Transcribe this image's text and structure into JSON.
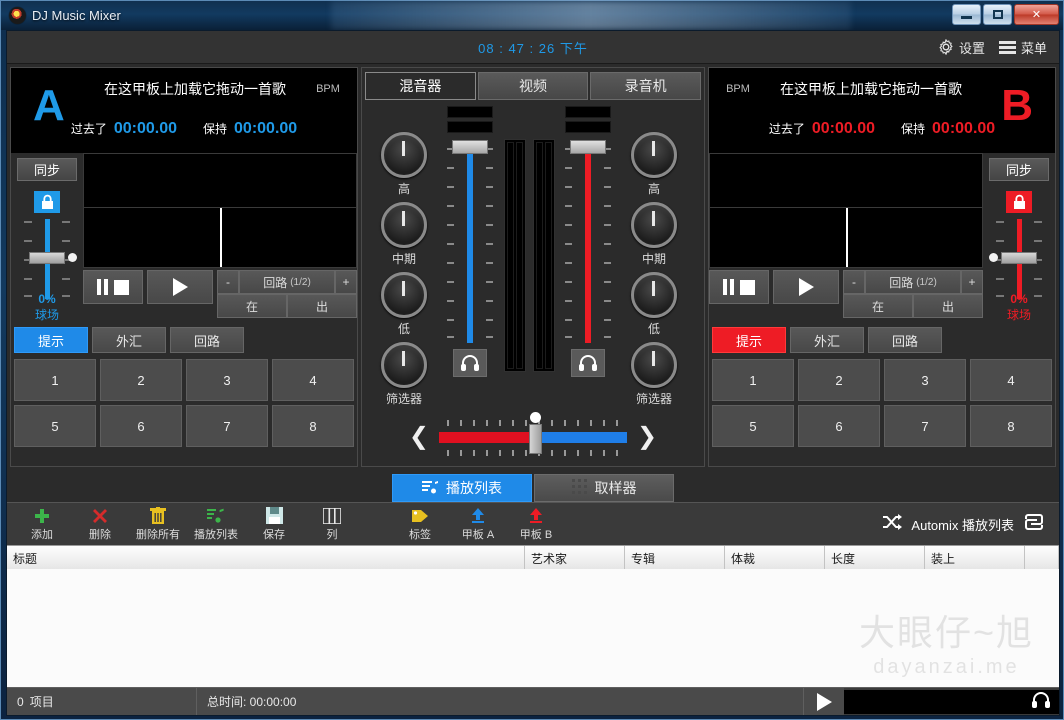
{
  "window": {
    "title": "DJ Music Mixer",
    "icon": "vinyl-record-icon",
    "minimize": "—",
    "maximize": "□",
    "close": "✕"
  },
  "topbar": {
    "clock": "08 : 47 : 26 下午",
    "settings_label": "设置",
    "menu_label": "菜单"
  },
  "deck_a": {
    "letter": "A",
    "accent": "#1f9ae8",
    "load_hint": "在这甲板上加载它拖动一首歌",
    "bpm_label": "BPM",
    "elapsed_label": "过去了",
    "elapsed_value": "00:00.00",
    "remain_label": "保持",
    "remain_value": "00:00.00",
    "sync_label": "同步",
    "lock_icon": "lock-icon",
    "pitch_value": "0%",
    "pitch_label": "球场",
    "transport": {
      "pause_stop": "pause-stop-icon",
      "play": "play-icon",
      "loop_minus": "-",
      "loop_label": "回路",
      "loop_value": "(1/2)",
      "loop_plus": "+",
      "loop_in": "在",
      "loop_out": "出"
    },
    "pad_tabs": [
      {
        "label": "提示",
        "active": true
      },
      {
        "label": "外汇",
        "active": false
      },
      {
        "label": "回路",
        "active": false
      }
    ],
    "pads": [
      "1",
      "2",
      "3",
      "4",
      "5",
      "6",
      "7",
      "8"
    ]
  },
  "deck_b": {
    "letter": "B",
    "accent": "#ee1c25",
    "load_hint": "在这甲板上加载它拖动一首歌",
    "bpm_label": "BPM",
    "elapsed_label": "过去了",
    "elapsed_value": "00:00.00",
    "remain_label": "保持",
    "remain_value": "00:00.00",
    "sync_label": "同步",
    "lock_icon": "lock-icon",
    "pitch_value": "0%",
    "pitch_label": "球场",
    "transport": {
      "pause_stop": "pause-stop-icon",
      "play": "play-icon",
      "loop_minus": "-",
      "loop_label": "回路",
      "loop_value": "(1/2)",
      "loop_plus": "+",
      "loop_in": "在",
      "loop_out": "出"
    },
    "pad_tabs": [
      {
        "label": "提示",
        "active": true
      },
      {
        "label": "外汇",
        "active": false
      },
      {
        "label": "回路",
        "active": false
      }
    ],
    "pads": [
      "1",
      "2",
      "3",
      "4",
      "5",
      "6",
      "7",
      "8"
    ]
  },
  "mixer": {
    "tabs": [
      {
        "label": "混音器",
        "active": true
      },
      {
        "label": "视频",
        "active": false
      },
      {
        "label": "录音机",
        "active": false
      }
    ],
    "eq_left": [
      {
        "label": "高"
      },
      {
        "label": "中期"
      },
      {
        "label": "低"
      },
      {
        "label": "筛选器"
      }
    ],
    "eq_right": [
      {
        "label": "高"
      },
      {
        "label": "中期"
      },
      {
        "label": "低"
      },
      {
        "label": "筛选器"
      }
    ],
    "cue_icon": "headphones-icon",
    "crossfader": {
      "left_arrow": "❮",
      "right_arrow": "❯",
      "position": 50
    }
  },
  "playlist": {
    "tabs": [
      {
        "label": "播放列表",
        "icon": "playlist-icon",
        "active": true
      },
      {
        "label": "取样器",
        "icon": "grid-icon",
        "active": false
      }
    ],
    "toolbar": [
      {
        "label": "添加",
        "icon": "plus-icon",
        "color": "#3cb54a"
      },
      {
        "label": "删除",
        "icon": "cross-icon",
        "color": "#d42b2b"
      },
      {
        "label": "删除所有",
        "icon": "trash-icon",
        "color": "#e8c020"
      },
      {
        "label": "播放列表",
        "icon": "playlist-note-icon",
        "color": "#3cb54a"
      },
      {
        "label": "保存",
        "icon": "floppy-icon",
        "color": "#cfe8e8"
      },
      {
        "label": "列",
        "icon": "columns-icon",
        "color": "#e8e8e8"
      },
      {
        "label": "标签",
        "icon": "tag-icon",
        "color": "#e8c020"
      },
      {
        "label": "甲板 A",
        "icon": "arrow-up-icon",
        "color": "#1f8ae8"
      },
      {
        "label": "甲板 B",
        "icon": "arrow-up-icon",
        "color": "#ee1c25"
      }
    ],
    "automix": {
      "shuffle_icon": "shuffle-icon",
      "label": "Automix 播放列表",
      "repeat_icon": "repeat-icon"
    },
    "columns": [
      "标题",
      "艺术家",
      "专辑",
      "体裁",
      "长度",
      "装上"
    ],
    "rows": []
  },
  "statusbar": {
    "item_count": "0",
    "item_label": "项目",
    "total_time": "总时间: 00:00:00",
    "preview_play_icon": "play-icon",
    "preview_cue_icon": "headphones-icon"
  },
  "watermark": {
    "line1": "大眼仔~旭",
    "line2": "dayanzai.me"
  }
}
